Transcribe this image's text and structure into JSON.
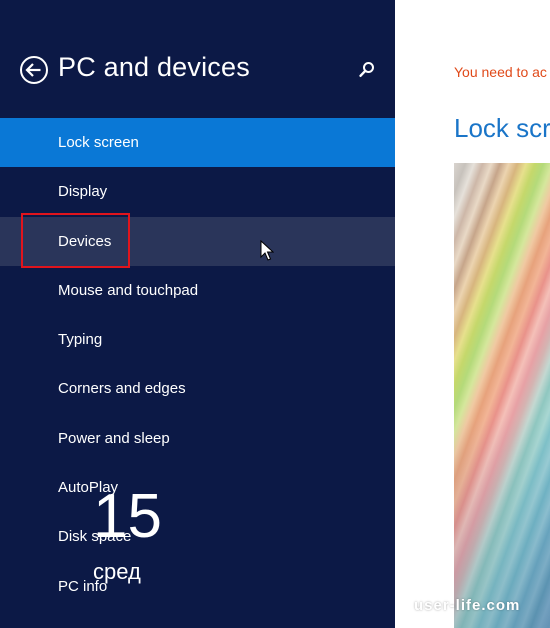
{
  "sidebar": {
    "title": "PC and devices",
    "back_icon": "back-arrow-circle-icon",
    "search_icon": "search-icon",
    "items": [
      {
        "label": "Lock screen",
        "state": "selected"
      },
      {
        "label": "Display",
        "state": "normal"
      },
      {
        "label": "Devices",
        "state": "hover"
      },
      {
        "label": "Mouse and touchpad",
        "state": "normal"
      },
      {
        "label": "Typing",
        "state": "normal"
      },
      {
        "label": "Corners and edges",
        "state": "normal"
      },
      {
        "label": "Power and sleep",
        "state": "normal"
      },
      {
        "label": "AutoPlay",
        "state": "normal"
      },
      {
        "label": "Disk space",
        "state": "normal"
      },
      {
        "label": "PC info",
        "state": "normal"
      }
    ]
  },
  "content": {
    "warning": "You need to ac",
    "section_title": "Lock scre",
    "preview_time": "15",
    "preview_day": "сред"
  },
  "watermark": "user-life.com",
  "colors": {
    "sidebar_bg": "#0c1946",
    "selected_bg": "#0a78d6",
    "hover_bg": "#2a355a",
    "highlight_border": "#e0141c",
    "warning_text": "#e04a1a",
    "accent_title": "#1a75c8"
  }
}
